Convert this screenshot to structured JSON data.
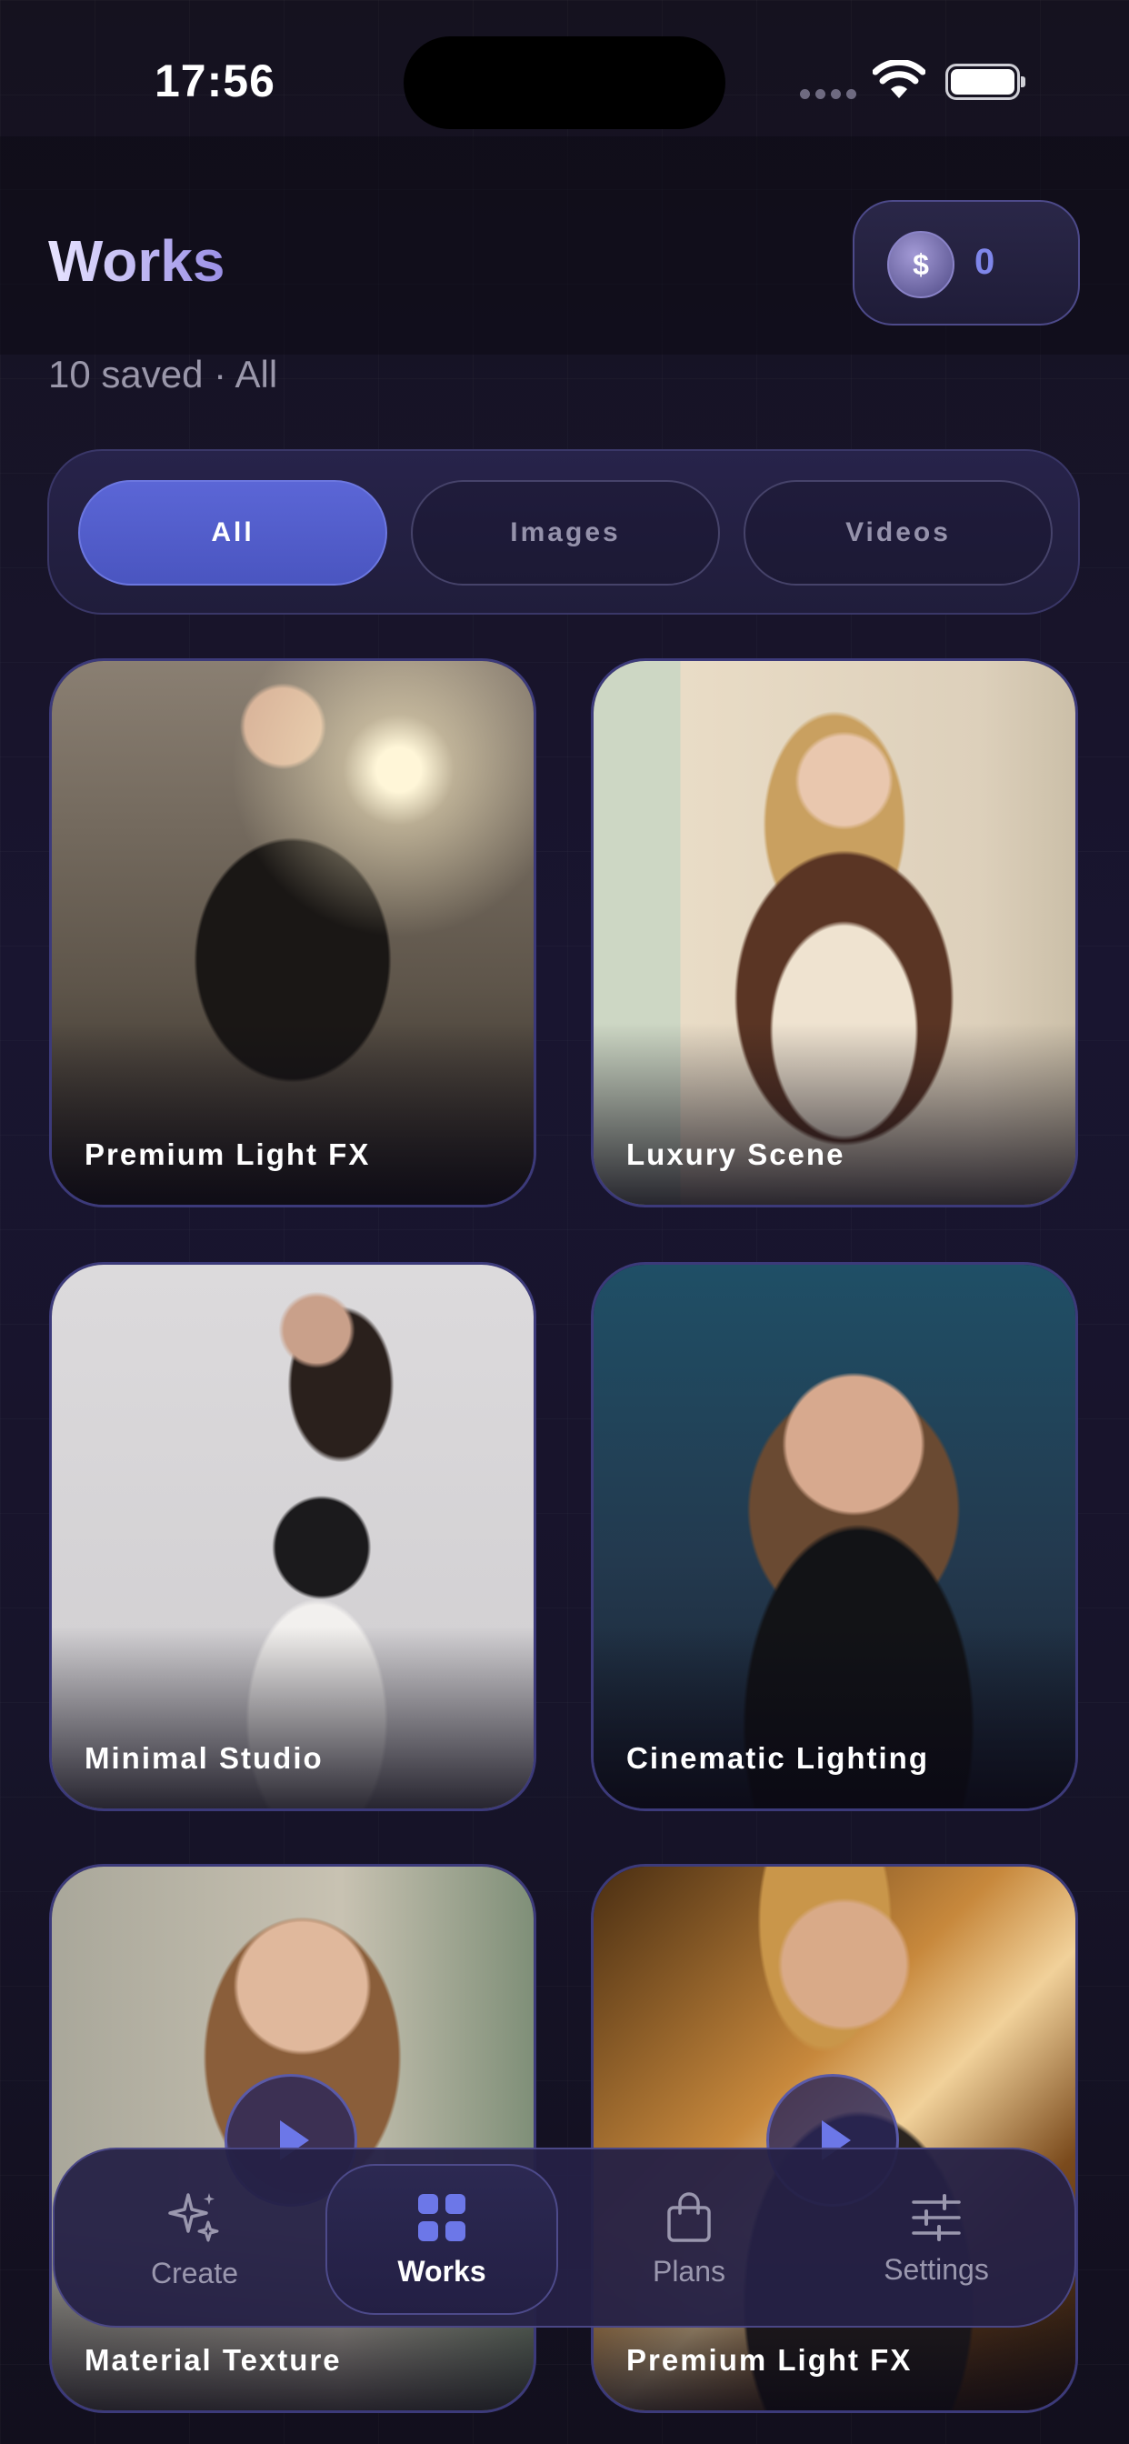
{
  "status_bar": {
    "time": "17:56"
  },
  "header": {
    "title": "Works",
    "coins": {
      "symbol": "$",
      "count": "0"
    },
    "subtitle": "10 saved · All"
  },
  "filters": [
    {
      "label": "All",
      "active": true
    },
    {
      "label": "Images",
      "active": false
    },
    {
      "label": "Videos",
      "active": false
    }
  ],
  "works": [
    {
      "label": "Premium Light FX",
      "type": "image"
    },
    {
      "label": "Luxury Scene",
      "type": "image"
    },
    {
      "label": "Minimal Studio",
      "type": "image"
    },
    {
      "label": "Cinematic Lighting",
      "type": "image"
    },
    {
      "label": "Material Texture",
      "type": "video"
    },
    {
      "label": "Premium Light FX",
      "type": "video"
    }
  ],
  "tab_bar": {
    "items": [
      {
        "label": "Create",
        "icon": "sparkles-icon",
        "active": false
      },
      {
        "label": "Works",
        "icon": "grid-icon",
        "active": true
      },
      {
        "label": "Plans",
        "icon": "bag-icon",
        "active": false
      },
      {
        "label": "Settings",
        "icon": "sliders-icon",
        "active": false
      }
    ]
  },
  "colors": {
    "accent": "#5b66d6",
    "background": "#17142a",
    "card_border": "#3c3a7a"
  }
}
